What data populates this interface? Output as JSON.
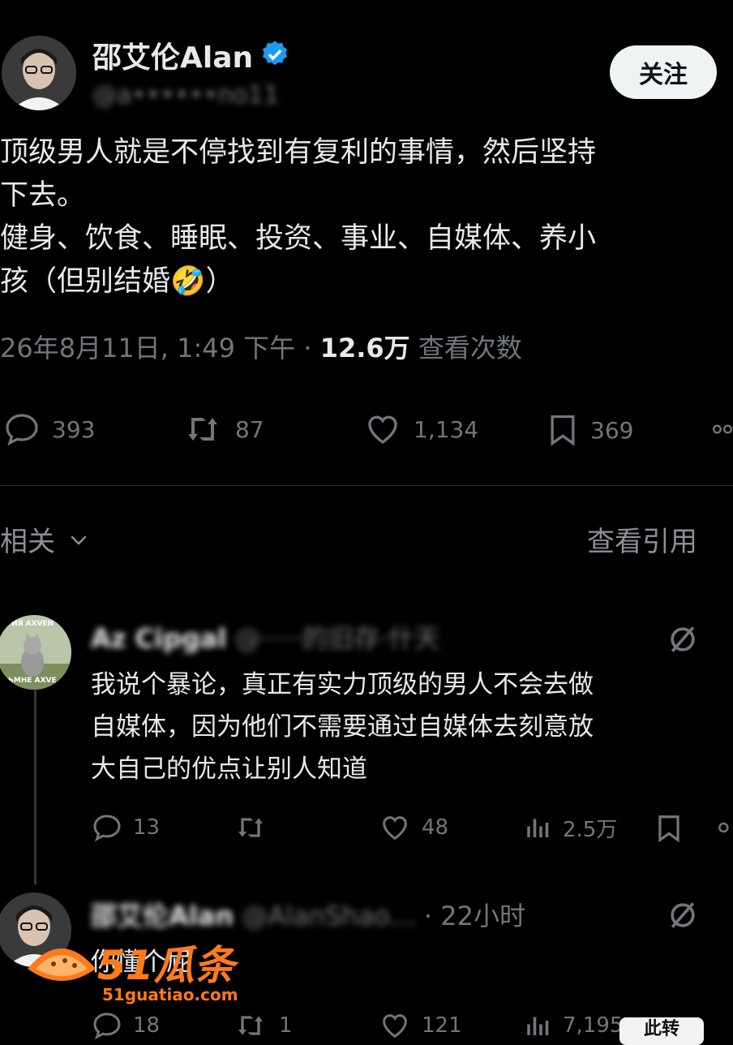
{
  "tweet": {
    "author_name": "邵艾伦Alan",
    "handle": "@a••••••no11",
    "follow_label": "关注",
    "text_lines": [
      "顶级男人就是不停找到有复利的事情，然后坚持",
      "下去。",
      "健身、饮食、睡眠、投资、事业、自媒体、养小",
      "孩（但别结婚🤣）"
    ],
    "timestamp": "26年8月11日, 1:49 下午",
    "views_count": "12.6万",
    "views_label": "查看次数",
    "stats": {
      "replies": "393",
      "retweets": "87",
      "likes": "1,134",
      "bookmarks": "369"
    }
  },
  "related": {
    "label": "相关",
    "view_quotes": "查看引用"
  },
  "replies": [
    {
      "author": "Az Cipgal",
      "meta": "@·····的旧存·什天",
      "text_lines": [
        "我说个暴论，真正有实力顶级的男人不会去做",
        "自媒体，因为他们不需要通过自媒体去刻意放",
        "大自己的优点让别人知道"
      ],
      "stats": {
        "replies": "13",
        "likes": "48",
        "views": "2.5万"
      },
      "avatar_text_top": "ИЯ AXVEN",
      "avatar_text_bottom": "ЬМНЕ AXVE"
    },
    {
      "author": "邵艾伦Alan",
      "meta": "@AlanShao…",
      "time": "· 22小时",
      "text_lines": [
        "你懂个屁"
      ],
      "stats": {
        "replies": "18",
        "retweets": "1",
        "likes": "121",
        "views": "7,195"
      }
    }
  ],
  "watermark": {
    "brand": "51瓜条",
    "url": "51guatiao.com",
    "corner": "此转"
  },
  "colors": {
    "background": "#000000",
    "text": "#e7e9ea",
    "muted": "#71767b",
    "verified": "#1d9bf0",
    "watermark": "#ff7a1a"
  }
}
